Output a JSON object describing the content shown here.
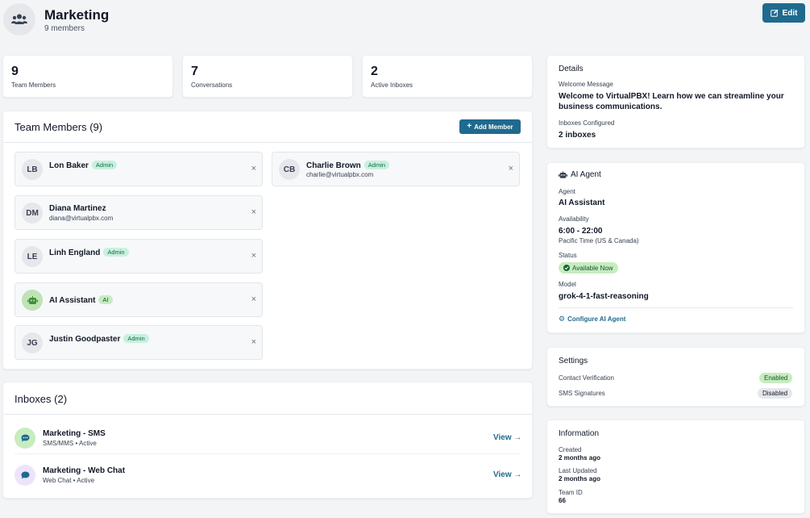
{
  "header": {
    "title": "Marketing",
    "subtitle": "9 members",
    "edit_label": "Edit"
  },
  "stats": [
    {
      "value": "9",
      "label": "Team Members"
    },
    {
      "value": "7",
      "label": "Conversations"
    },
    {
      "value": "2",
      "label": "Active Inboxes"
    }
  ],
  "members_section": {
    "title": "Team Members (9)",
    "add_label": "Add Member",
    "remove_glyph": "×",
    "members": [
      {
        "initials": "LB",
        "name": "Lon Baker",
        "badge": "Admin",
        "email": ""
      },
      {
        "initials": "CB",
        "name": "Charlie Brown",
        "badge": "Admin",
        "email": "charlie@virtualpbx.com"
      },
      {
        "initials": "DM",
        "name": "Diana Martinez",
        "badge": "",
        "email": "diana@virtualpbx.com"
      },
      {
        "initials": "LE",
        "name": "Linh England",
        "badge": "Admin",
        "email": ""
      },
      {
        "initials": "",
        "name": "AI Assistant",
        "badge": "AI",
        "email": ""
      },
      {
        "initials": "JG",
        "name": "Justin Goodpaster",
        "badge": "Admin",
        "email": ""
      }
    ]
  },
  "inboxes_section": {
    "title": "Inboxes (2)",
    "inboxes": [
      {
        "name": "Marketing - SMS",
        "sub": "SMS/MMS • Active",
        "view": "View →",
        "icon_color": "#c7ecbf",
        "glyph_color": "#1f6a8e"
      },
      {
        "name": "Marketing - Web Chat",
        "sub": "Web Chat • Active",
        "view": "View →",
        "icon_color": "#ede4fb",
        "glyph_color": "#1f6a8e"
      }
    ]
  },
  "details": {
    "title": "Details",
    "welcome_label": "Welcome Message",
    "welcome_line1": "Welcome to VirtualPBX! Learn how we can streamline your",
    "welcome_line2": "business communications.",
    "inboxes_label": "Inboxes Configured",
    "inboxes_value": "2 inboxes"
  },
  "ai_agent": {
    "title": "AI Agent",
    "agent_label": "Agent",
    "agent_value": "AI Assistant",
    "availability_label": "Availability",
    "availability_value": "6:00 - 22:00",
    "timezone": "Pacific Time (US & Canada)",
    "status_label": "Status",
    "status_value": "Available Now",
    "model_label": "Model",
    "model_value": "grok-4-1-fast-reasoning",
    "configure_label": "Configure AI Agent"
  },
  "settings": {
    "title": "Settings",
    "rows": [
      {
        "label": "Contact Verification",
        "value": "Enabled"
      },
      {
        "label": "SMS Signatures",
        "value": "Disabled"
      }
    ]
  },
  "information": {
    "title": "Information",
    "created_label": "Created",
    "created_value": "2 months ago",
    "updated_label": "Last Updated",
    "updated_value": "2 months ago",
    "team_id_label": "Team ID",
    "team_id_value": "66"
  },
  "colors": {
    "primary": "#1f6a8e",
    "admin_badge": "#c8f0df",
    "enabled": "#c7ecbf",
    "disabled": "#e5e7eb"
  }
}
